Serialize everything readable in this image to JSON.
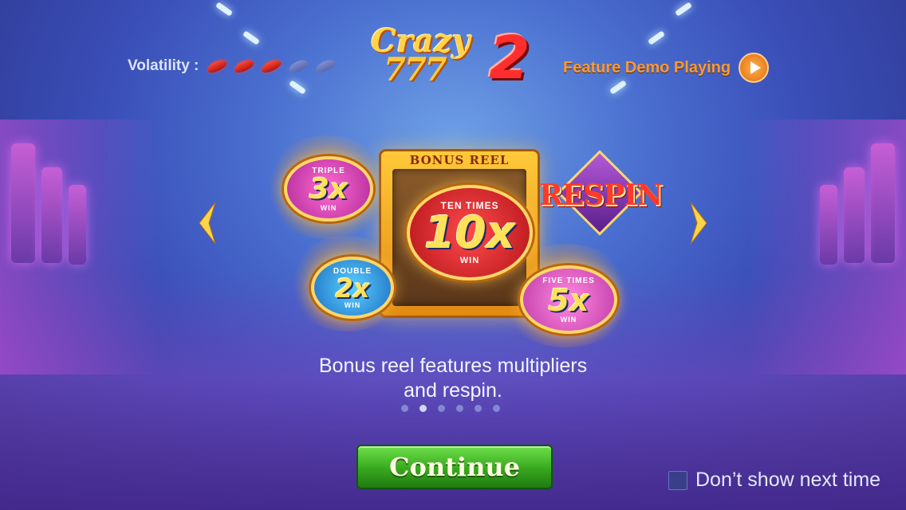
{
  "header": {
    "volatility_label": "Volatility :",
    "volatility": {
      "level": 3,
      "max": 5
    },
    "logo_line1": "Crazy",
    "logo_line2": "777",
    "logo_number": "2",
    "demo_label": "Feature Demo Playing"
  },
  "features": {
    "reel_title": "BONUS REEL",
    "medal_3x": {
      "cap": "TRIPLE",
      "mult": "3x",
      "win": "WIN"
    },
    "medal_2x": {
      "cap": "DOUBLE",
      "mult": "2x",
      "win": "WIN"
    },
    "medal_10x": {
      "cap": "TEN TIMES",
      "mult": "10x",
      "win": "WIN"
    },
    "medal_5x": {
      "cap": "FIVE TIMES",
      "mult": "5x",
      "win": "WIN"
    },
    "respin_label": "RESPIN"
  },
  "description": {
    "line1": "Bonus reel features multipliers",
    "line2": "and respin."
  },
  "pagination": {
    "count": 6,
    "active_index": 1
  },
  "buttons": {
    "continue_label": "Continue"
  },
  "footer": {
    "dont_show_label": "Don’t show next time",
    "dont_show_checked": false
  }
}
